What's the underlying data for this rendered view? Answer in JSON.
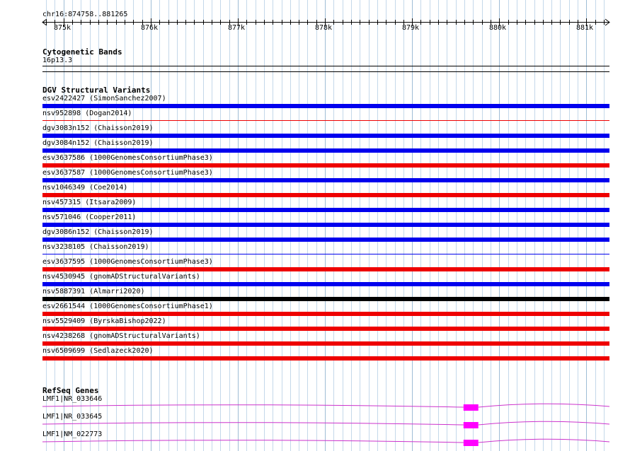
{
  "ruler": {
    "position_label": "chr16:874758..881265",
    "view_start": 874758,
    "view_end": 881265,
    "ticks": [
      {
        "pos": 875000,
        "label": "875k"
      },
      {
        "pos": 876000,
        "label": "876k"
      },
      {
        "pos": 877000,
        "label": "877k"
      },
      {
        "pos": 878000,
        "label": "878k"
      },
      {
        "pos": 879000,
        "label": "879k"
      },
      {
        "pos": 880000,
        "label": "880k"
      },
      {
        "pos": 881000,
        "label": "881k"
      }
    ]
  },
  "tracks": {
    "cytoband": {
      "title": "Cytogenetic Bands",
      "band_label": "16p13.3"
    },
    "dgv": {
      "title": "DGV Structural Variants",
      "colors": {
        "blue": "#0000ee",
        "red": "#ee0000",
        "black": "#000000"
      },
      "features": [
        {
          "label": "esv2422427 (SimonSanchez2007)",
          "color": "blue",
          "bar": "thick"
        },
        {
          "label": "nsv952898 (Dogan2014)",
          "color": "red",
          "bar": "thin"
        },
        {
          "label": "dgv3083n152 (Chaisson2019)",
          "color": "blue",
          "bar": "thick"
        },
        {
          "label": "dgv3084n152 (Chaisson2019)",
          "color": "blue",
          "bar": "thick"
        },
        {
          "label": "esv3637586 (1000GenomesConsortiumPhase3)",
          "color": "red",
          "bar": "thick"
        },
        {
          "label": "esv3637587 (1000GenomesConsortiumPhase3)",
          "color": "blue",
          "bar": "thick"
        },
        {
          "label": "nsv1046349 (Coe2014)",
          "color": "red",
          "bar": "thick"
        },
        {
          "label": "nsv457315 (Itsara2009)",
          "color": "blue",
          "bar": "thick"
        },
        {
          "label": "nsv571046 (Cooper2011)",
          "color": "blue",
          "bar": "thick"
        },
        {
          "label": "dgv3086n152 (Chaisson2019)",
          "color": "blue",
          "bar": "thick"
        },
        {
          "label": "nsv3238105 (Chaisson2019)",
          "color": "blue",
          "bar": "thin"
        },
        {
          "label": "esv3637595 (1000GenomesConsortiumPhase3)",
          "color": "red",
          "bar": "thick"
        },
        {
          "label": "nsv4530945 (gnomADStructuralVariants)",
          "color": "blue",
          "bar": "thick"
        },
        {
          "label": "nsv5887391 (Almarri2020)",
          "color": "black",
          "bar": "thick"
        },
        {
          "label": "esv2661544 (1000GenomesConsortiumPhase1)",
          "color": "red",
          "bar": "thick"
        },
        {
          "label": "nsv5529409 (ByrskaBishop2022)",
          "color": "red",
          "bar": "thick"
        },
        {
          "label": "nsv4238268 (gnomADStructuralVariants)",
          "color": "red",
          "bar": "thick"
        },
        {
          "label": "nsv6509699 (Sedlazeck2020)",
          "color": "red",
          "bar": "thick"
        }
      ]
    },
    "refseq": {
      "title": "RefSeq Genes",
      "intron_color": "#cc33cc",
      "exon_color": "#ff00ff",
      "exon_start": 879590,
      "exon_end": 879760,
      "genes": [
        {
          "label": "LMF1|NR_033646"
        },
        {
          "label": "LMF1|NR_033645"
        },
        {
          "label": "LMF1|NM_022773"
        }
      ]
    }
  }
}
